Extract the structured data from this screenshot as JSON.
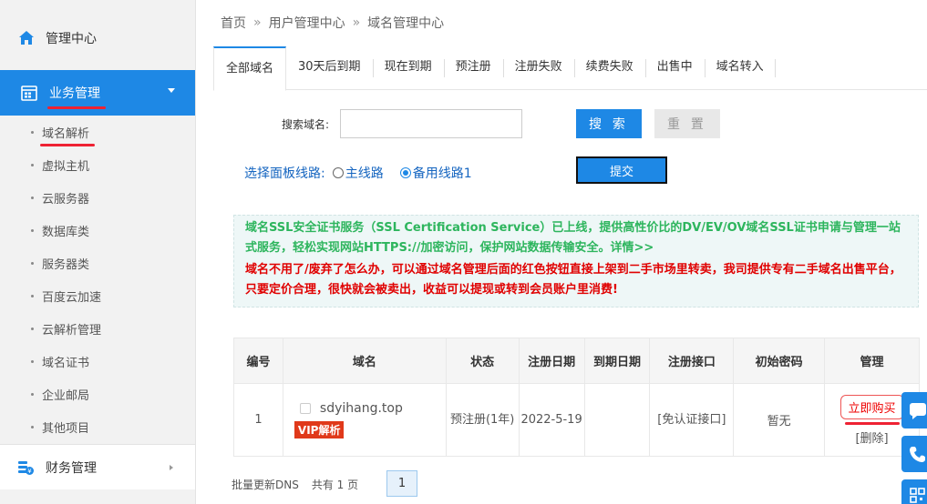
{
  "sidebar": {
    "home_label": "管理中心",
    "active_section": "业务管理",
    "items": [
      {
        "label": "域名解析"
      },
      {
        "label": "虚拟主机"
      },
      {
        "label": "云服务器"
      },
      {
        "label": "数据库类"
      },
      {
        "label": "服务器类"
      },
      {
        "label": "百度云加速"
      },
      {
        "label": "云解析管理"
      },
      {
        "label": "域名证书"
      },
      {
        "label": "企业邮局"
      },
      {
        "label": "其他项目"
      }
    ],
    "finance_label": "财务管理"
  },
  "breadcrumb": {
    "home": "首页",
    "sep": "»",
    "level1": "用户管理中心",
    "level2": "域名管理中心"
  },
  "tabs": [
    "全部域名",
    "30天后到期",
    "现在到期",
    "预注册",
    "注册失败",
    "续费失败",
    "出售中",
    "域名转入"
  ],
  "search": {
    "label": "搜索域名:",
    "value": "",
    "search_label": "搜 索",
    "reset_label": "重 置"
  },
  "line_select": {
    "label": "选择面板线路:",
    "options": [
      "主线路",
      "备用线路1"
    ],
    "selected": "备用线路1",
    "submit_label": "提交"
  },
  "notice": {
    "ssl": "域名SSL安全证书服务（SSL Certification Service）已上线，提供高性价比的DV/EV/OV域名SSL证书申请与管理一站式服务，轻松实现网站HTTPS://加密访问，保护网站数据传输安全。详情>>",
    "resale": "域名不用了/废弃了怎么办，可以通过域名管理后面的红色按钮直接上架到二手市场里转卖，我司提供专有二手域名出售平台，只要定价合理，很快就会被卖出，收益可以提现或转到会员账户里消费!"
  },
  "table": {
    "headers": [
      "编号",
      "域名",
      "状态",
      "注册日期",
      "到期日期",
      "注册接口",
      "初始密码",
      "管理"
    ],
    "rows": [
      {
        "id": "1",
        "domain": "sdyihang.top",
        "vip": "VIP解析",
        "status": "预注册(1年)",
        "reg_date": "2022-5-19",
        "exp_date": "",
        "reg_port": "[免认证接口]",
        "init_pass": "暂无",
        "buy_label": "立即购买",
        "delete_label": "[删除]"
      }
    ]
  },
  "footer": {
    "batch_label": "批量更新DNS",
    "total_text": "共有 1 页",
    "current_page": "1"
  }
}
